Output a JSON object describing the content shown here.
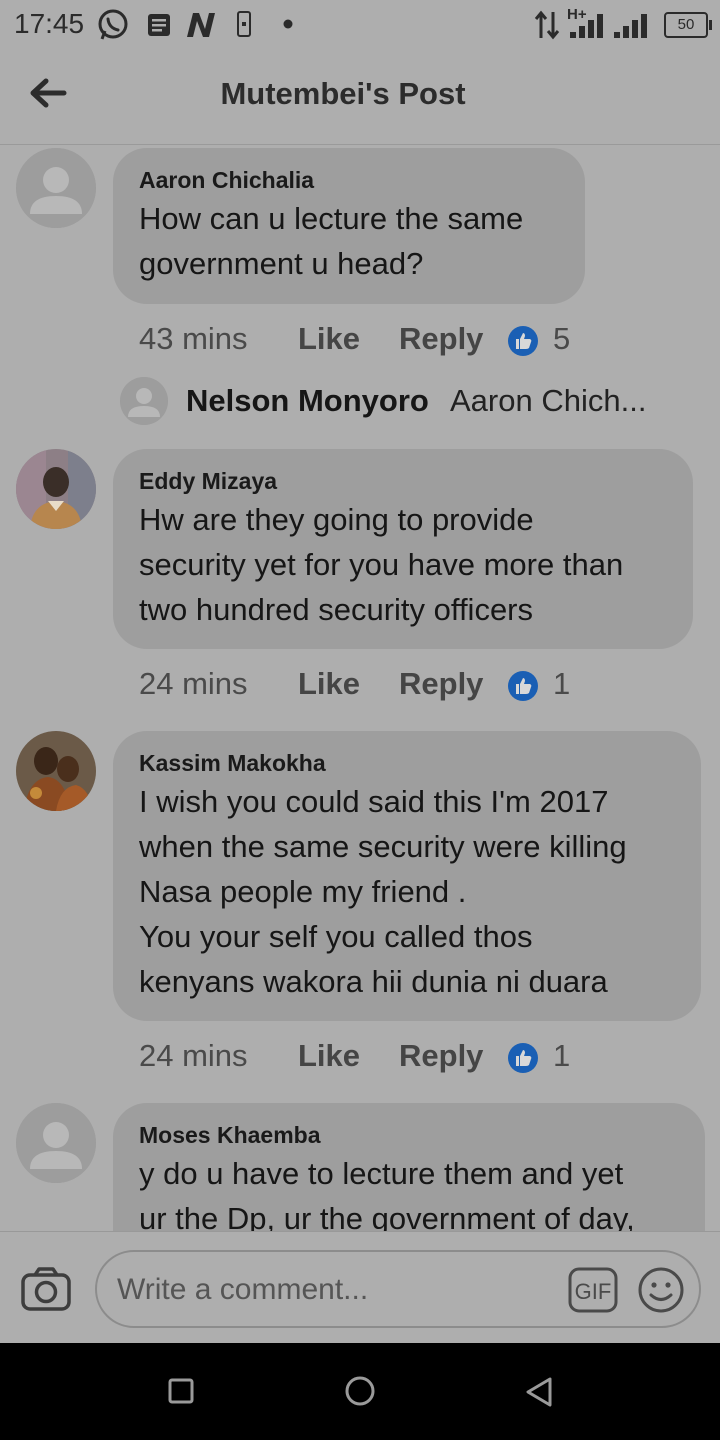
{
  "status_bar": {
    "time": "17:45",
    "network_label": "H+",
    "battery": "50",
    "icons": [
      "whatsapp-icon",
      "message-icon",
      "n-app-icon",
      "sim-icon",
      "dot-icon",
      "data-transfer-icon",
      "signal-icon",
      "signal-icon",
      "battery-icon"
    ]
  },
  "header": {
    "title": "Mutembei's Post",
    "back_icon": "arrow-left-icon"
  },
  "colors": {
    "background": "#aeaeae",
    "bubble": "#9e9e9e",
    "like_blue": "#1a5fb4",
    "nav_bar": "#000000"
  },
  "comments": [
    {
      "author": "Aaron Chichalia",
      "text": "How can u lecture the same\ngovernment u head?",
      "time": "43 mins",
      "like_label": "Like",
      "reply_label": "Reply",
      "reactions": "5",
      "avatar": "default-avatar"
    },
    {
      "author": "Eddy Mizaya",
      "text": "Hw are they going to provide\nsecurity yet for you have more than\ntwo hundred security officers",
      "time": "24 mins",
      "like_label": "Like",
      "reply_label": "Reply",
      "reactions": "1",
      "avatar": "photo-avatar"
    },
    {
      "author": "Kassim Makokha",
      "text": "I wish you could said this I'm 2017\nwhen the same security were killing\nNasa people my friend .\nYou your self you called thos\nkenyans wakora hii dunia ni duara",
      "time": "24 mins",
      "like_label": "Like",
      "reply_label": "Reply",
      "reactions": "1",
      "avatar": "artwork-avatar"
    },
    {
      "author": "Moses Khaemba",
      "text": "y do u have to lecture them and yet\nur the Dp, ur the government of day,",
      "avatar": "default-avatar"
    }
  ],
  "reply_preview": {
    "name": "Nelson Monyoro",
    "snippet": "Aaron Chich..."
  },
  "composer": {
    "placeholder": "Write a comment...",
    "gif_label": "GIF",
    "camera_icon": "camera-icon",
    "emoji_icon": "emoji-icon"
  },
  "nav": {
    "icons": [
      "recents-square-icon",
      "home-circle-icon",
      "back-triangle-icon"
    ]
  }
}
